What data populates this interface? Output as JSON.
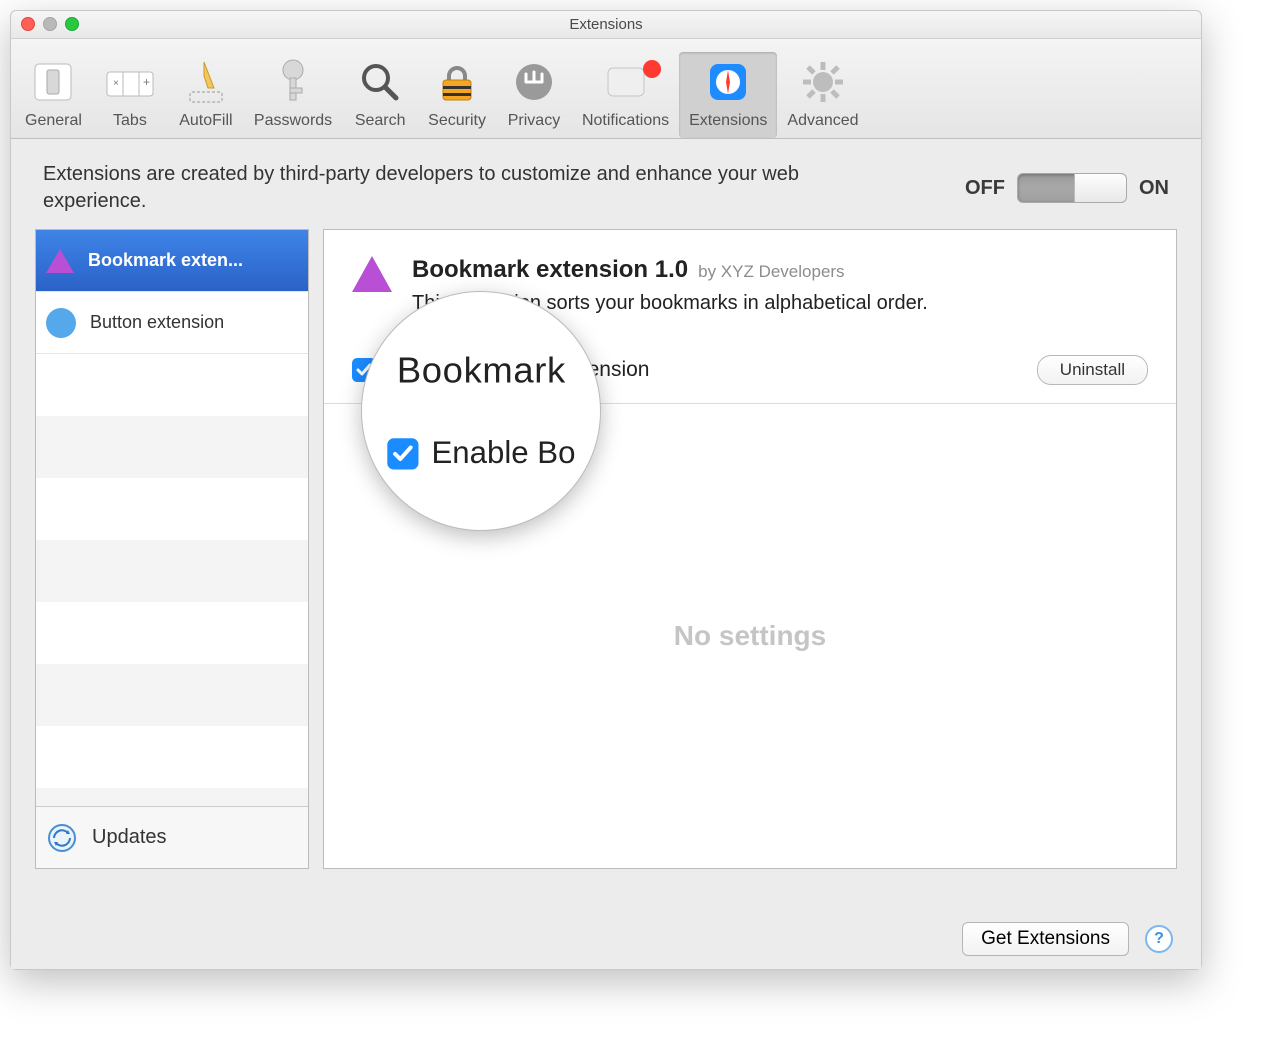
{
  "window": {
    "title": "Extensions"
  },
  "toolbar": {
    "items": [
      {
        "label": "General"
      },
      {
        "label": "Tabs"
      },
      {
        "label": "AutoFill"
      },
      {
        "label": "Passwords"
      },
      {
        "label": "Search"
      },
      {
        "label": "Security"
      },
      {
        "label": "Privacy"
      },
      {
        "label": "Notifications"
      },
      {
        "label": "Extensions"
      },
      {
        "label": "Advanced"
      }
    ]
  },
  "intro": {
    "text": "Extensions are created by third-party developers to customize and enhance your web experience.",
    "off": "OFF",
    "on": "ON"
  },
  "sidebar": {
    "items": [
      {
        "label": "Bookmark exten..."
      },
      {
        "label": "Button extension"
      }
    ],
    "updates": "Updates"
  },
  "details": {
    "title": "Bookmark extension 1.0",
    "by": "by XYZ Developers",
    "desc": "This extension sorts your bookmarks in alphabetical order.",
    "enable": "Enable Bookmark extension",
    "uninstall": "Uninstall",
    "no_settings": "No settings"
  },
  "magnifier": {
    "title": "Bookmark",
    "enable": "Enable Bo"
  },
  "footer": {
    "get": "Get Extensions",
    "help": "?"
  }
}
